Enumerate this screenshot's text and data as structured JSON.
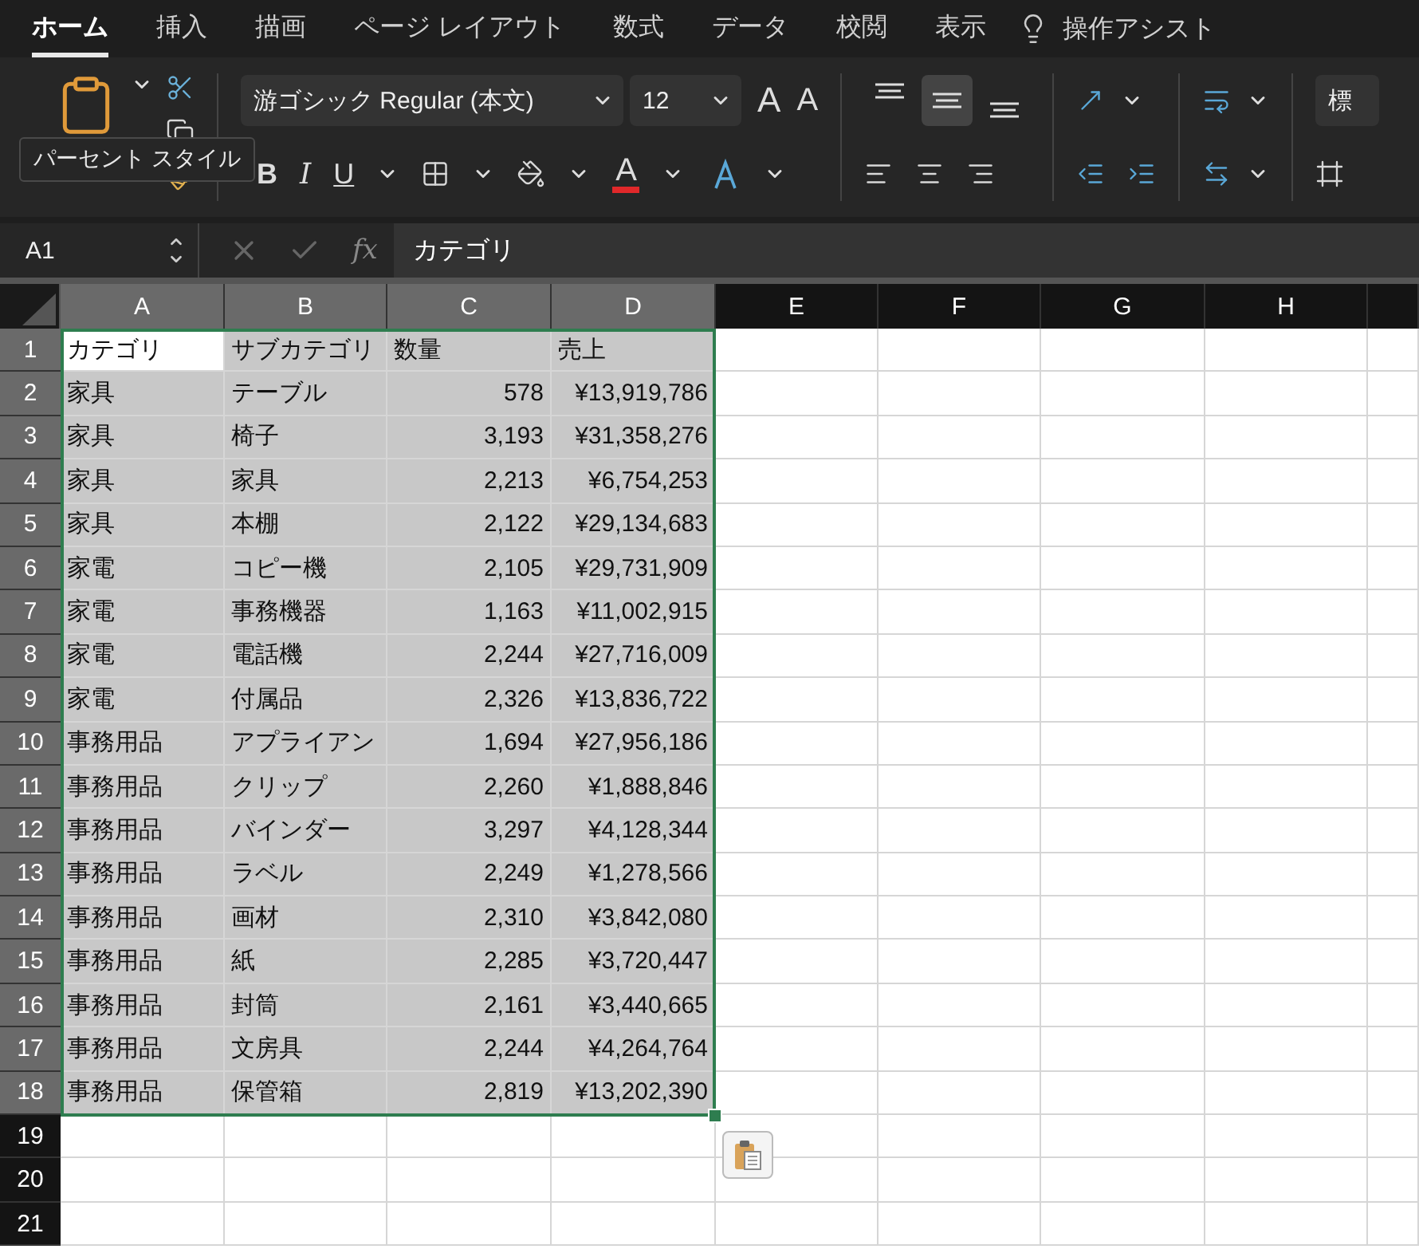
{
  "menu_tabs": [
    {
      "label": "ホーム",
      "selected": true
    },
    {
      "label": "挿入",
      "selected": false
    },
    {
      "label": "描画",
      "selected": false
    },
    {
      "label": "ページ レイアウト",
      "selected": false
    },
    {
      "label": "数式",
      "selected": false
    },
    {
      "label": "データ",
      "selected": false
    },
    {
      "label": "校閲",
      "selected": false
    },
    {
      "label": "表示",
      "selected": false
    }
  ],
  "assist": {
    "label": "操作アシスト"
  },
  "ribbon": {
    "font_name": "游ゴシック Regular (本文)",
    "font_size": "12",
    "grow_font": "A",
    "shrink_font": "A",
    "bold": "B",
    "italic": "I",
    "underline": "U",
    "font_color": "A",
    "vertical_align": [
      {
        "selected": false
      },
      {
        "selected": true
      },
      {
        "selected": false
      }
    ],
    "style_field": "標"
  },
  "tooltip": {
    "text": "パーセント スタイル"
  },
  "formula_bar": {
    "name_box": "A1",
    "fx": "fx",
    "formula": "カテゴリ"
  },
  "sheet": {
    "columns": [
      {
        "label": "A",
        "selected": true
      },
      {
        "label": "B",
        "selected": true
      },
      {
        "label": "C",
        "selected": true
      },
      {
        "label": "D",
        "selected": true
      },
      {
        "label": "E",
        "selected": false
      },
      {
        "label": "F",
        "selected": false
      },
      {
        "label": "G",
        "selected": false
      },
      {
        "label": "H",
        "selected": false
      }
    ],
    "rows": [
      {
        "header": "1",
        "kind": "header",
        "selected": true,
        "active": true,
        "cells": [
          "カテゴリ",
          "サブカテゴリ",
          "数量",
          "売上"
        ]
      },
      {
        "header": "2",
        "kind": "data",
        "selected": true,
        "active": false,
        "cells": [
          "家具",
          "テーブル",
          "578",
          "¥13,919,786"
        ]
      },
      {
        "header": "3",
        "kind": "data",
        "selected": true,
        "active": false,
        "cells": [
          "家具",
          "椅子",
          "3,193",
          "¥31,358,276"
        ]
      },
      {
        "header": "4",
        "kind": "data",
        "selected": true,
        "active": false,
        "cells": [
          "家具",
          "家具",
          "2,213",
          "¥6,754,253"
        ]
      },
      {
        "header": "5",
        "kind": "data",
        "selected": true,
        "active": false,
        "cells": [
          "家具",
          "本棚",
          "2,122",
          "¥29,134,683"
        ]
      },
      {
        "header": "6",
        "kind": "data",
        "selected": true,
        "active": false,
        "cells": [
          "家電",
          "コピー機",
          "2,105",
          "¥29,731,909"
        ]
      },
      {
        "header": "7",
        "kind": "data",
        "selected": true,
        "active": false,
        "cells": [
          "家電",
          "事務機器",
          "1,163",
          "¥11,002,915"
        ]
      },
      {
        "header": "8",
        "kind": "data",
        "selected": true,
        "active": false,
        "cells": [
          "家電",
          "電話機",
          "2,244",
          "¥27,716,009"
        ]
      },
      {
        "header": "9",
        "kind": "data",
        "selected": true,
        "active": false,
        "cells": [
          "家電",
          "付属品",
          "2,326",
          "¥13,836,722"
        ]
      },
      {
        "header": "10",
        "kind": "data",
        "selected": true,
        "active": false,
        "cells": [
          "事務用品",
          "アプライアン",
          "1,694",
          "¥27,956,186"
        ]
      },
      {
        "header": "11",
        "kind": "data",
        "selected": true,
        "active": false,
        "cells": [
          "事務用品",
          "クリップ",
          "2,260",
          "¥1,888,846"
        ]
      },
      {
        "header": "12",
        "kind": "data",
        "selected": true,
        "active": false,
        "cells": [
          "事務用品",
          "バインダー",
          "3,297",
          "¥4,128,344"
        ]
      },
      {
        "header": "13",
        "kind": "data",
        "selected": true,
        "active": false,
        "cells": [
          "事務用品",
          "ラベル",
          "2,249",
          "¥1,278,566"
        ]
      },
      {
        "header": "14",
        "kind": "data",
        "selected": true,
        "active": false,
        "cells": [
          "事務用品",
          "画材",
          "2,310",
          "¥3,842,080"
        ]
      },
      {
        "header": "15",
        "kind": "data",
        "selected": true,
        "active": false,
        "cells": [
          "事務用品",
          "紙",
          "2,285",
          "¥3,720,447"
        ]
      },
      {
        "header": "16",
        "kind": "data",
        "selected": true,
        "active": false,
        "cells": [
          "事務用品",
          "封筒",
          "2,161",
          "¥3,440,665"
        ]
      },
      {
        "header": "17",
        "kind": "data",
        "selected": true,
        "active": false,
        "cells": [
          "事務用品",
          "文房具",
          "2,244",
          "¥4,264,764"
        ]
      },
      {
        "header": "18",
        "kind": "data",
        "selected": true,
        "active": false,
        "cells": [
          "事務用品",
          "保管箱",
          "2,819",
          "¥13,202,390"
        ]
      },
      {
        "header": "19",
        "kind": "empty",
        "selected": false,
        "active": false
      },
      {
        "header": "20",
        "kind": "empty",
        "selected": false,
        "active": false
      },
      {
        "header": "21",
        "kind": "empty",
        "selected": false,
        "active": false
      }
    ]
  }
}
